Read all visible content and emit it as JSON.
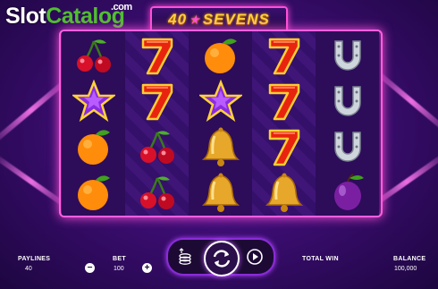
{
  "branding": {
    "site_name_part1": "Slot",
    "site_name_part2": "Catalog",
    "site_suffix": ".com"
  },
  "game": {
    "title_number": "40",
    "title_word": "SEVENS"
  },
  "reels": [
    [
      "cherries",
      "star",
      "orange",
      "orange"
    ],
    [
      "seven",
      "seven",
      "cherries",
      "cherries"
    ],
    [
      "orange",
      "star",
      "bell",
      "bell"
    ],
    [
      "seven",
      "seven",
      "seven",
      "bell"
    ],
    [
      "horseshoe",
      "horseshoe",
      "horseshoe",
      "plum"
    ]
  ],
  "controls": {
    "paylines_label": "PAYLINES",
    "paylines_value": "40",
    "bet_label": "BET",
    "bet_value": "100",
    "total_win_label": "TOTAL WIN",
    "total_win_value": "",
    "balance_label": "BALANCE",
    "balance_value": "100,000",
    "decrease_symbol": "−",
    "increase_symbol": "+",
    "icons": {
      "bet_chips": "coin-stack-icon",
      "spin": "spin-icon",
      "autoplay": "autoplay-icon"
    }
  },
  "colors": {
    "frame_glow": "#ff4fd8",
    "title_gold": "#ffd23a",
    "logo_green": "#4fbf2f"
  }
}
